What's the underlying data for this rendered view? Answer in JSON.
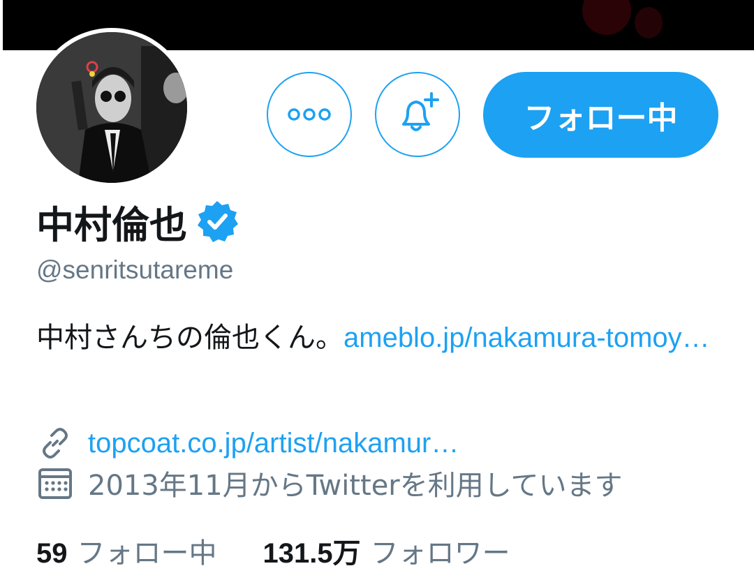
{
  "profile": {
    "name": "中村倫也",
    "handle": "@senritsutareme",
    "bio_text": "中村さんちの倫也くん。",
    "bio_link": "ameblo.jp/nakamura-tomoy…",
    "website": "topcoat.co.jp/artist/nakamur…",
    "joined": "2013年11月からTwitterを利用しています",
    "verified": true
  },
  "actions": {
    "follow_label": "フォロー中",
    "more_icon": "more-icon",
    "notify_icon": "bell-plus-icon"
  },
  "stats": {
    "following_count": "59",
    "following_label": "フォロー中",
    "followers_count": "131.5万",
    "followers_label": "フォロワー"
  },
  "colors": {
    "accent": "#1da1f2",
    "text": "#14171a",
    "muted": "#657786"
  }
}
